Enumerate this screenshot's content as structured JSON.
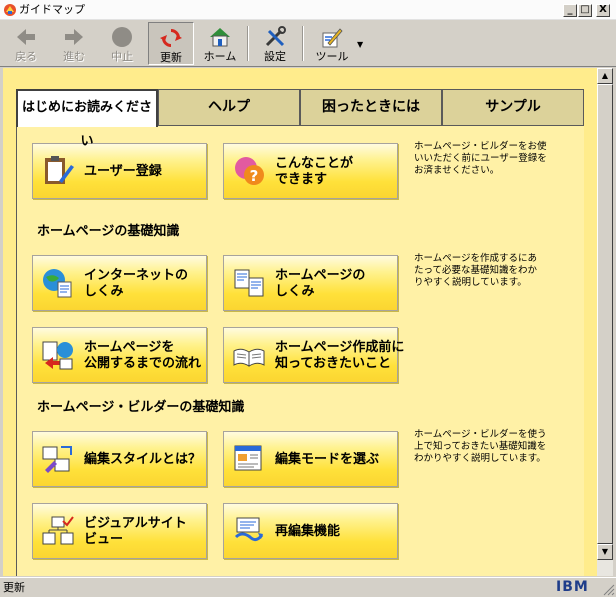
{
  "window": {
    "title": "ガイドマップ",
    "buttons": {
      "minimize": "_",
      "maximize": "□",
      "close": "X"
    }
  },
  "toolbar": {
    "back": "戻る",
    "forward": "進む",
    "stop": "中止",
    "refresh": "更新",
    "home": "ホーム",
    "settings": "設定",
    "tools": "ツール"
  },
  "tabs": [
    "はじめにお読みください",
    "ヘルプ",
    "困ったときには",
    "サンプル"
  ],
  "intro": {
    "buttons": [
      "ユーザー登録",
      "こんなことが\nできます"
    ],
    "description": "ホームページ・ビルダーをお使\nいいただく前にユーザー登録を\nお済ませください。"
  },
  "basics": {
    "heading": "ホームページの基礎知識",
    "buttons": [
      "インターネットの\nしくみ",
      "ホームページの\nしくみ",
      "ホームページを\n公開するまでの流れ",
      "ホームページ作成前に\n知っておきたいこと"
    ],
    "description": "ホームページを作成するにあ\nたって必要な基礎知識をわか\nりやすく説明しています。"
  },
  "builder": {
    "heading": "ホームページ・ビルダーの基礎知識",
    "buttons": [
      "編集スタイルとは？",
      "編集モードを選ぶ",
      "ビジュアルサイト\nビュー",
      "再編集機能"
    ],
    "description": "ホームページ・ビルダーを使う\n上で知っておきたい基礎知識を\nわかりやすく説明しています。"
  },
  "scrollbar": {
    "up": "▲",
    "down": "▼"
  },
  "status": {
    "text": "更新",
    "logo": "IBM"
  },
  "colors": {
    "content_bg": "#ffec8c",
    "button_yellow": "#ffe13a",
    "chrome": "#d4d0c8"
  }
}
